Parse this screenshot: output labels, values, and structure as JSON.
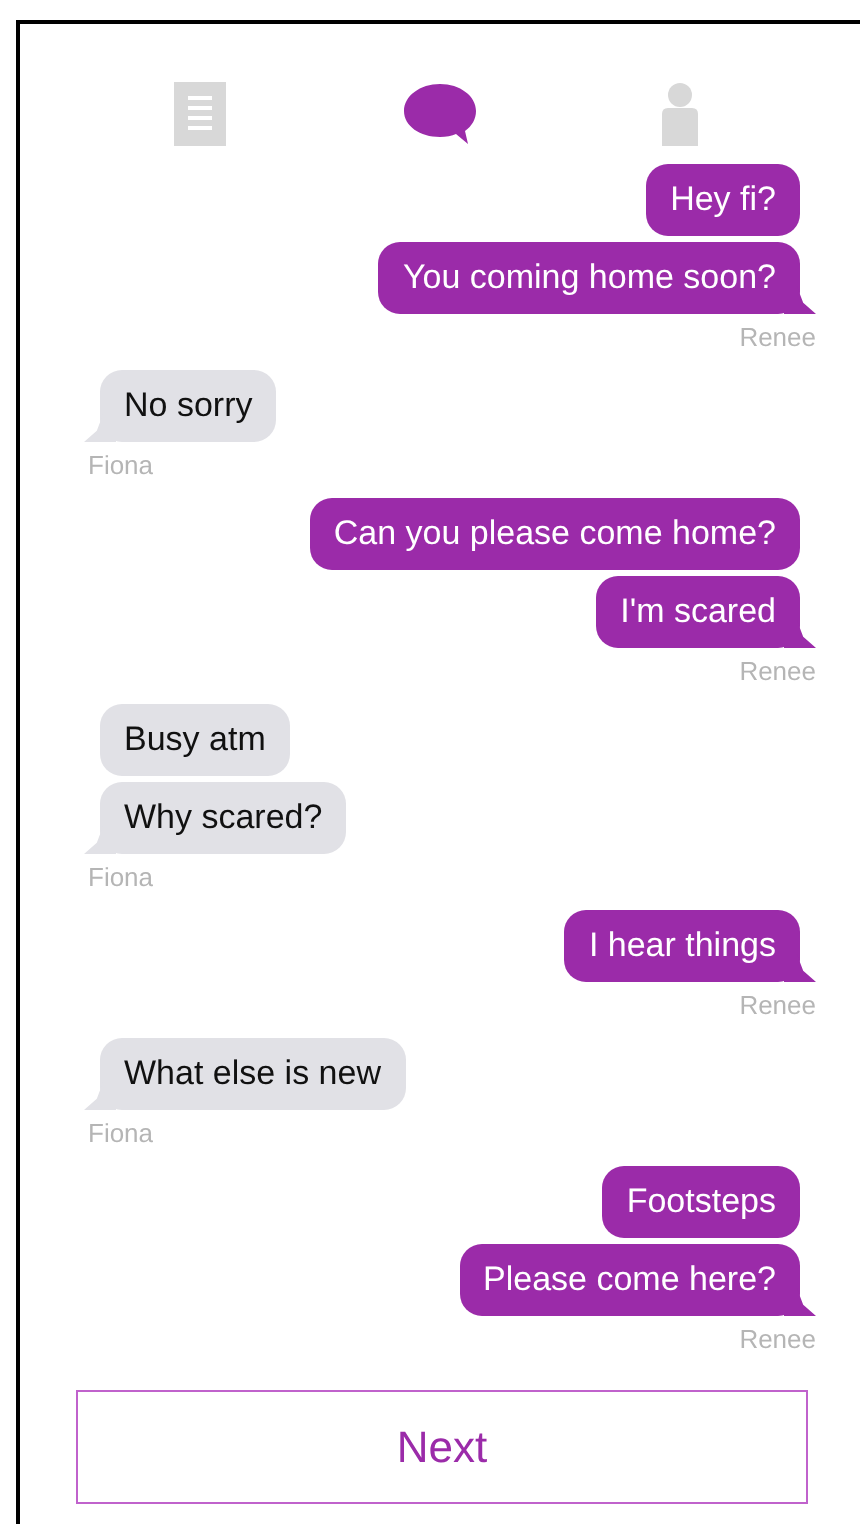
{
  "tabs": [
    {
      "kind": "notes",
      "selected": false
    },
    {
      "kind": "chat",
      "selected": true
    },
    {
      "kind": "contact",
      "selected": false
    }
  ],
  "groups": [
    {
      "kind": "sent",
      "sender": "Renee",
      "messages": [
        "Hey fi?",
        "You coming home soon?"
      ]
    },
    {
      "kind": "received",
      "sender": "Fiona",
      "messages": [
        "No sorry"
      ]
    },
    {
      "kind": "sent",
      "sender": "Renee",
      "messages": [
        "Can you please come home?",
        "I'm scared"
      ]
    },
    {
      "kind": "received",
      "sender": "Fiona",
      "messages": [
        "Busy atm",
        "Why scared?"
      ]
    },
    {
      "kind": "sent",
      "sender": "Renee",
      "messages": [
        "I hear things"
      ]
    },
    {
      "kind": "received",
      "sender": "Fiona",
      "messages": [
        "What else is new"
      ]
    },
    {
      "kind": "sent",
      "sender": "Renee",
      "messages": [
        "Footsteps",
        "Please come here?"
      ]
    }
  ],
  "next_button": "Next"
}
